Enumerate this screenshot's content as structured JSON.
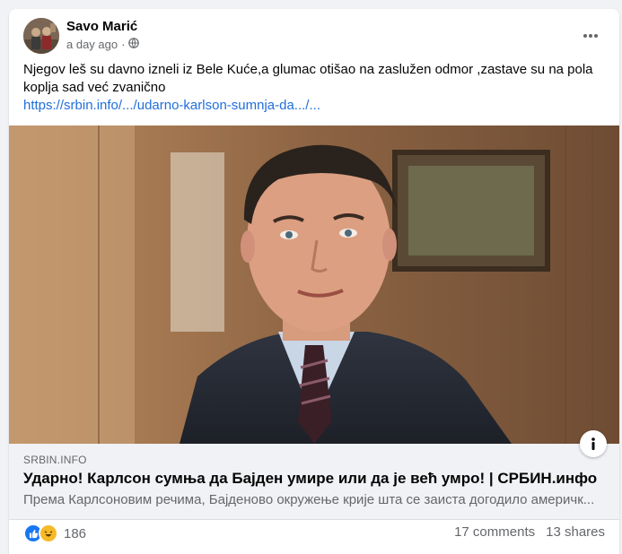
{
  "post": {
    "author": "Savo Marić",
    "time": "a day ago",
    "audience_icon": "globe-icon",
    "text": "Njegov leš su davno izneli iz Bele Kuće,a glumac otišao na zaslužen odmor ,zastave su na pola koplja sad već zvanično",
    "link_text": "https://srbin.info/.../udarno-karlson-sumnja-da.../...",
    "more_icon": "more-horizontal-icon"
  },
  "link_preview": {
    "domain": "SRBIN.INFO",
    "title": "Ударно! Карлсон сумња да Бајден умире или да је већ умро! | СРБИН.инфо",
    "description": "Према Карлсоновим речима, Бајденово окружење крије шта се заиста догодило америчк..."
  },
  "footer": {
    "reactions": [
      "like-icon",
      "haha-icon"
    ],
    "reaction_count": "186",
    "comments": "17 comments",
    "shares": "13 shares"
  },
  "colors": {
    "link": "#216fdb",
    "like": "#1877f2",
    "haha": "#f7b928",
    "secondary_text": "#65676b",
    "preview_bg": "#f0f2f5"
  }
}
